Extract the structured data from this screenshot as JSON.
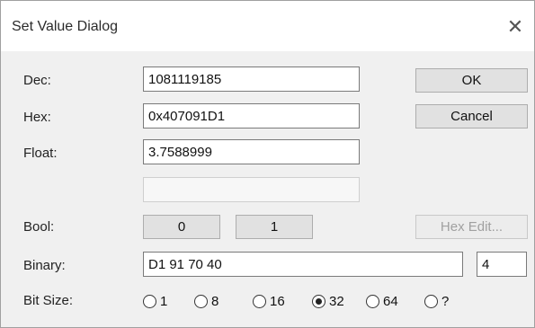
{
  "dialog": {
    "title": "Set Value Dialog",
    "close_glyph": "✕"
  },
  "labels": {
    "dec": "Dec:",
    "hex": "Hex:",
    "float": "Float:",
    "bool": "Bool:",
    "binary": "Binary:",
    "bit_size": "Bit Size:"
  },
  "values": {
    "dec": "1081119185",
    "hex": "0x407091D1",
    "float": "3.7588999",
    "extra": "",
    "binary": "D1 91 70 40",
    "byte_count": "4"
  },
  "buttons": {
    "ok": "OK",
    "cancel": "Cancel",
    "bool_0": "0",
    "bool_1": "1",
    "hex_edit": "Hex Edit..."
  },
  "bit_size": {
    "options": [
      "1",
      "8",
      "16",
      "32",
      "64",
      "?"
    ],
    "selected": "32"
  }
}
